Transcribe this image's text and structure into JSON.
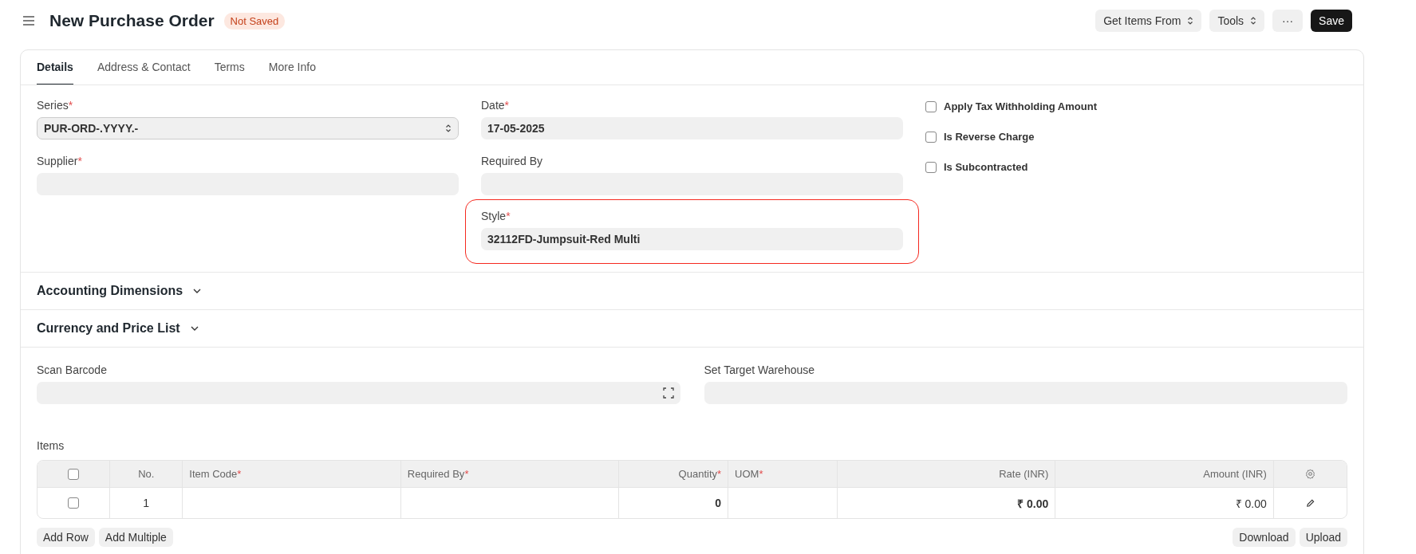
{
  "header": {
    "title": "New Purchase Order",
    "status": "Not Saved",
    "buttons": [
      {
        "kind": "dropdown",
        "label": "Get Items From"
      },
      {
        "kind": "dropdown",
        "label": "Tools"
      },
      {
        "kind": "more",
        "label": "···"
      },
      {
        "kind": "primary",
        "label": "Save"
      }
    ]
  },
  "tabs": [
    {
      "label": "Details",
      "selected": true
    },
    {
      "label": "Address & Contact",
      "selected": false
    },
    {
      "label": "Terms",
      "selected": false
    },
    {
      "label": "More Info",
      "selected": false
    }
  ],
  "details": {
    "columns": [
      [
        {
          "kind": "select",
          "label": "Series",
          "mark": "*",
          "value": "PUR-ORD-.YYYY.-"
        },
        {
          "kind": "input",
          "label": "Supplier",
          "mark": "*"
        }
      ],
      [
        {
          "kind": "input",
          "label": "Date",
          "mark": "*",
          "value": "17-05-2025"
        },
        {
          "kind": "input",
          "label": "Required By"
        },
        {
          "kind": "input",
          "label": "Style",
          "mark": "*",
          "value": "32112FD-Jumpsuit-Red Multi",
          "highlighted": true
        }
      ],
      [
        {
          "kind": "check",
          "label": "Apply Tax Withholding Amount",
          "checked": false
        },
        {
          "kind": "check",
          "label": "Is Reverse Charge",
          "checked": false
        },
        {
          "kind": "check",
          "label": "Is Subcontracted",
          "checked": false
        }
      ]
    ]
  },
  "sections": [
    {
      "title": "Accounting Dimensions",
      "expanded": false
    },
    {
      "title": "Currency and Price List",
      "expanded": false
    }
  ],
  "scan": [
    {
      "label": "Scan Barcode",
      "kind": "barcode"
    },
    {
      "label": "Set Target Warehouse",
      "kind": "input"
    }
  ],
  "items": {
    "label": "Items",
    "all_selected": false,
    "columns": [
      {
        "kind": "check"
      },
      {
        "kind": "num",
        "label": "No."
      },
      {
        "kind": "text",
        "label": "Item Code",
        "mark": "*"
      },
      {
        "kind": "text",
        "label": "Required By",
        "mark": "*"
      },
      {
        "kind": "right",
        "label": "Quantity",
        "mark": "*"
      },
      {
        "kind": "text",
        "label": "UOM",
        "mark": "*"
      },
      {
        "kind": "rightbold",
        "label": "Rate (INR)"
      },
      {
        "kind": "right",
        "label": "Amount (INR)"
      },
      {
        "kind": "settings"
      }
    ],
    "rows": [
      {
        "selected": false,
        "no": "1",
        "quantity": "0",
        "rate": "₹ 0.00",
        "amount": "₹ 0.00"
      }
    ],
    "left_buttons": [
      "Add Row",
      "Add Multiple"
    ],
    "right_buttons": [
      "Download",
      "Upload"
    ]
  }
}
